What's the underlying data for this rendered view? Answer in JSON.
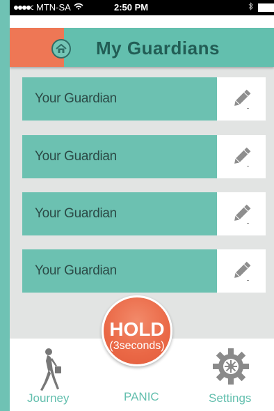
{
  "status_bar": {
    "carrier": "MTN-SA",
    "time": "2:50 PM"
  },
  "header": {
    "title": "My Guardians"
  },
  "guardians": [
    {
      "label": "Your Guardian"
    },
    {
      "label": "Your Guardian"
    },
    {
      "label": "Your Guardian"
    },
    {
      "label": "Your Guardian"
    }
  ],
  "panic_button": {
    "main": "HOLD",
    "sub": "(3seconds)"
  },
  "tabs": {
    "journey": "Journey",
    "panic": "PANIC",
    "settings": "Settings"
  },
  "colors": {
    "teal": "#63bfae",
    "orange": "#ee7755",
    "title_text": "#225d55"
  }
}
